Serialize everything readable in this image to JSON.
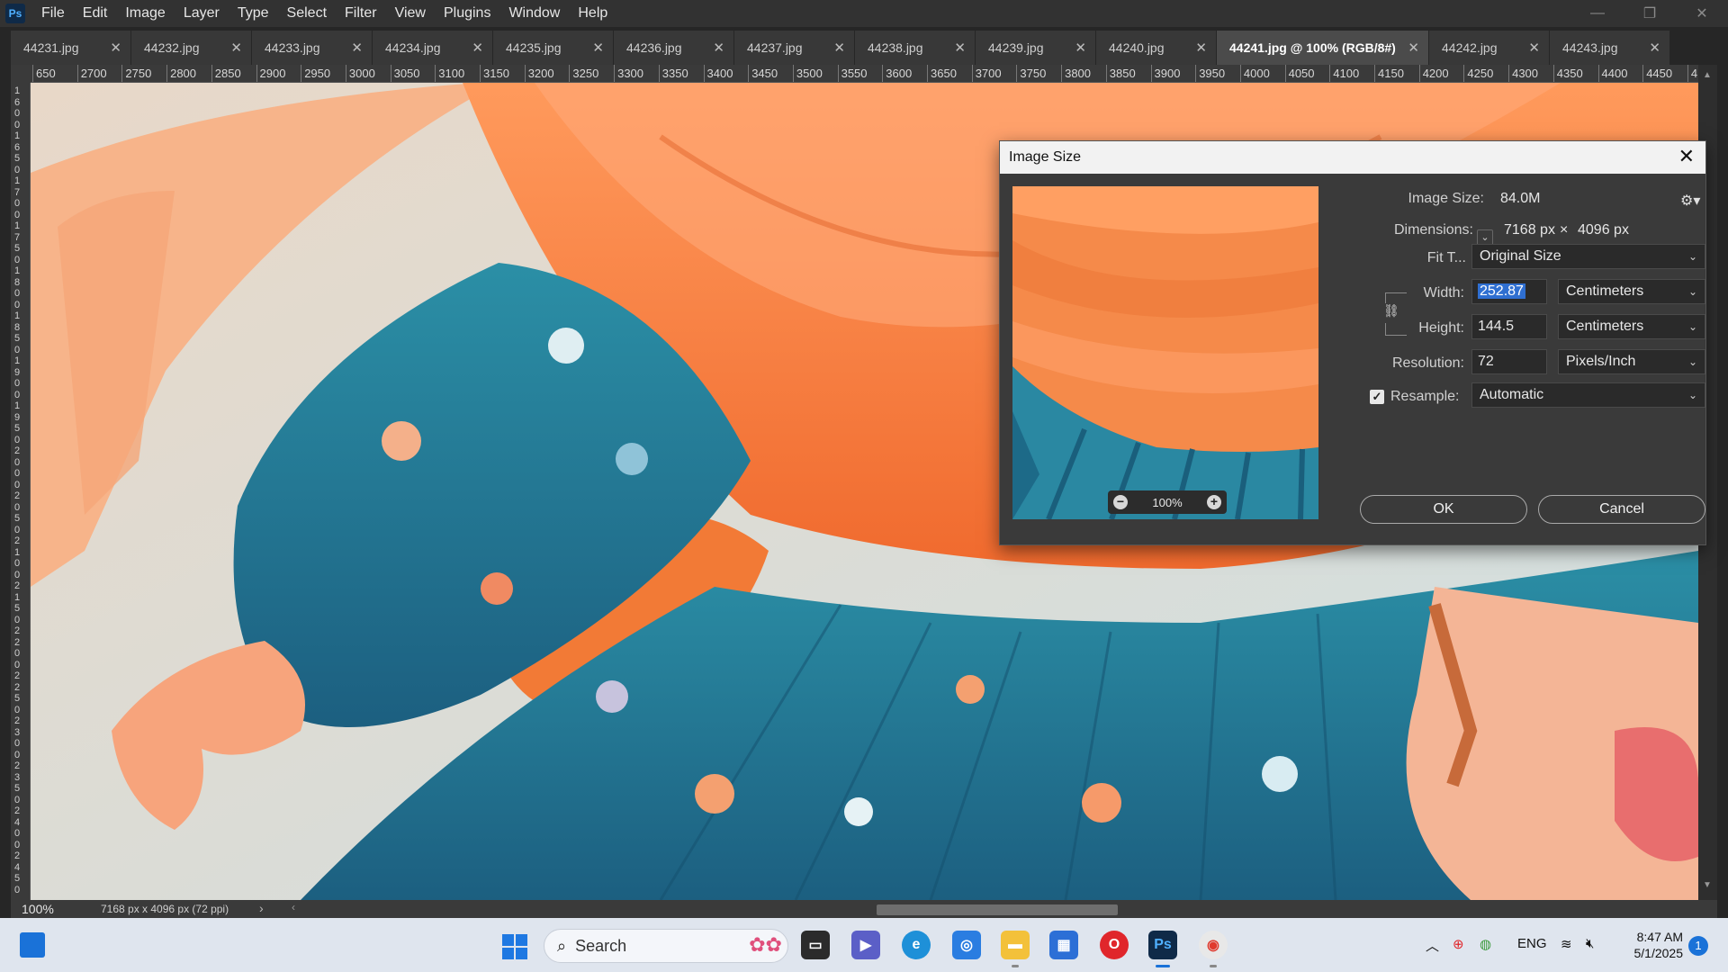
{
  "app": {
    "logo": "Ps",
    "menu": [
      "File",
      "Edit",
      "Image",
      "Layer",
      "Type",
      "Select",
      "Filter",
      "View",
      "Plugins",
      "Window",
      "Help"
    ],
    "window_controls": [
      "—",
      "❐",
      "✕"
    ]
  },
  "tabs": [
    {
      "label": "44231.jpg",
      "active": false
    },
    {
      "label": "44232.jpg",
      "active": false
    },
    {
      "label": "44233.jpg",
      "active": false
    },
    {
      "label": "44234.jpg",
      "active": false
    },
    {
      "label": "44235.jpg",
      "active": false
    },
    {
      "label": "44236.jpg",
      "active": false
    },
    {
      "label": "44237.jpg",
      "active": false
    },
    {
      "label": "44238.jpg",
      "active": false
    },
    {
      "label": "44239.jpg",
      "active": false
    },
    {
      "label": "44240.jpg",
      "active": false
    },
    {
      "label": "44241.jpg @ 100% (RGB/8#)",
      "active": true
    },
    {
      "label": "44242.jpg",
      "active": false
    },
    {
      "label": "44243.jpg",
      "active": false
    }
  ],
  "ruler": {
    "top_labels": [
      "650",
      "2700",
      "2750",
      "2800",
      "2850",
      "2900",
      "2950",
      "3000",
      "3050",
      "3100",
      "3150",
      "3200",
      "3250",
      "3300",
      "3350",
      "3400",
      "3450",
      "3500",
      "3550",
      "3600",
      "3650",
      "3700",
      "3750",
      "3800",
      "3850",
      "3900",
      "3950",
      "4000",
      "4050",
      "4100",
      "4150",
      "4200",
      "4250",
      "4300",
      "4350",
      "4400",
      "4450",
      "4"
    ],
    "left_labels": [
      "1",
      "6",
      "0",
      "0",
      "1",
      "6",
      "5",
      "0",
      "1",
      "7",
      "0",
      "0",
      "1",
      "7",
      "5",
      "0",
      "1",
      "8",
      "0",
      "0",
      "1",
      "8",
      "5",
      "0",
      "1",
      "9",
      "0",
      "0",
      "1",
      "9",
      "5",
      "0",
      "2",
      "0",
      "0",
      "0",
      "2",
      "0",
      "5",
      "0",
      "2",
      "1",
      "0",
      "0",
      "2",
      "1",
      "5",
      "0",
      "2",
      "2",
      "0",
      "0",
      "2",
      "2",
      "5",
      "0",
      "2",
      "3",
      "0",
      "0",
      "2",
      "3",
      "5",
      "0",
      "2",
      "4",
      "0",
      "0",
      "2",
      "4",
      "5",
      "0"
    ]
  },
  "status": {
    "zoom": "100%",
    "doc_info": "7168 px x 4096 px (72 ppi)"
  },
  "dialog": {
    "title": "Image Size",
    "close": "✕",
    "preview_zoom": "100%",
    "image_size_label": "Image Size:",
    "image_size_value": "84.0M",
    "dimensions_label": "Dimensions:",
    "dim_width": "7168 px",
    "dim_sep": "×",
    "dim_height": "4096 px",
    "fit_label": "Fit T...",
    "fit_value": "Original Size",
    "width_label": "Width:",
    "width_value": "252.87",
    "width_unit": "Centimeters",
    "height_label": "Height:",
    "height_value": "144.5",
    "height_unit": "Centimeters",
    "resolution_label": "Resolution:",
    "resolution_value": "72",
    "resolution_unit": "Pixels/Inch",
    "resample_label": "Resample:",
    "resample_checked": true,
    "resample_value": "Automatic",
    "ok": "OK",
    "cancel": "Cancel"
  },
  "taskbar": {
    "search_placeholder": "Search",
    "lang": "ENG",
    "time": "8:47 AM",
    "date": "5/1/2025",
    "notifications": "1"
  },
  "icons": {
    "accent": "#1a72d8"
  }
}
